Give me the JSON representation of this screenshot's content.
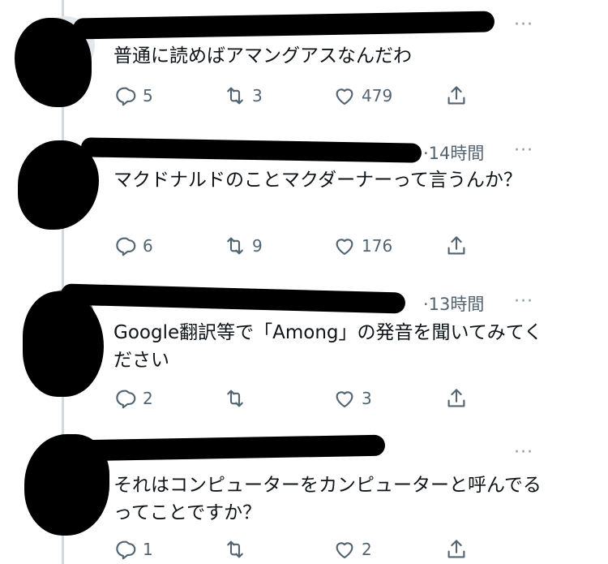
{
  "tweets": [
    {
      "time": "",
      "text": "普通に読めばアマングアスなんだわ",
      "replies": "5",
      "retweets": "3",
      "likes": "479"
    },
    {
      "time": "·14時間",
      "text": "マクドナルドのことマクダーナーって言うんか？",
      "replies": "6",
      "retweets": "9",
      "likes": "176"
    },
    {
      "time": "·13時間",
      "text": "Google翻訳等で「Among」の発音を聞いてみてください",
      "replies": "2",
      "retweets": "",
      "likes": "3"
    },
    {
      "time": "",
      "text": "それはコンピューターをカンピューターと呼んでるってことですか？",
      "replies": "1",
      "retweets": "",
      "likes": "2"
    }
  ],
  "more_glyph": "···",
  "icons": [
    "reply-icon",
    "retweet-icon",
    "like-icon",
    "share-icon",
    "more-icon"
  ],
  "colors": {
    "icon": "#536471",
    "thread_line": "#cfd9de",
    "redaction": "#000000"
  }
}
